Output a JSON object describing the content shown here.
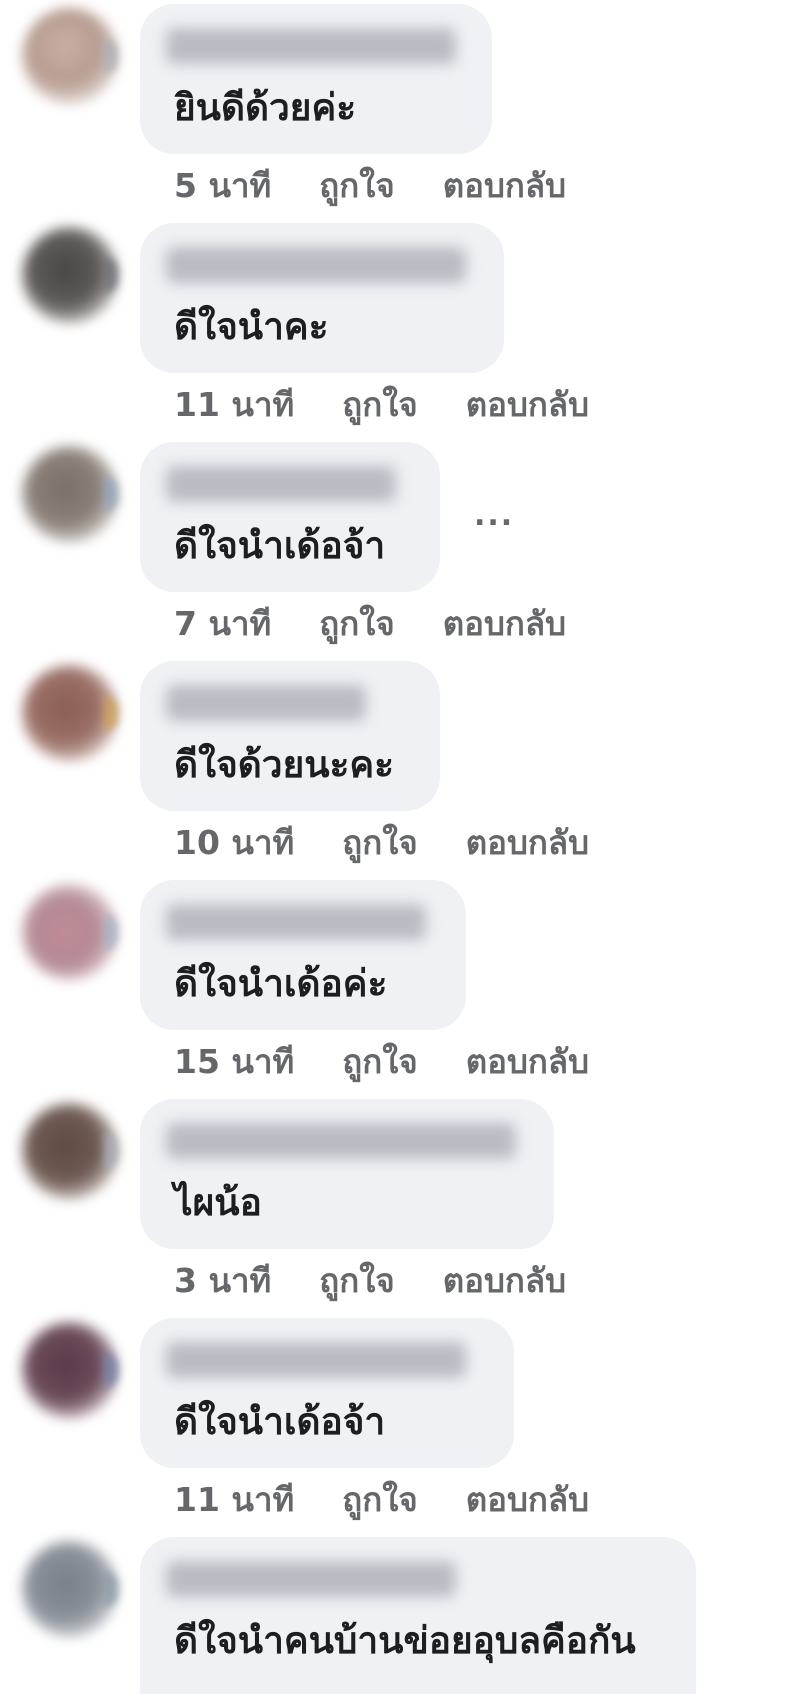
{
  "comments": [
    {
      "text": "ยินดีด้วยค่ะ",
      "time": "5 นาที",
      "like": "ถูกใจ",
      "reply": "ตอบกลับ",
      "avatar_color": "#b79c90"
    },
    {
      "text": "ดีใจนำคะ",
      "time": "11 นาที",
      "like": "ถูกใจ",
      "reply": "ตอบกลับ",
      "avatar_color": "#5e5a58"
    },
    {
      "text": "ดีใจนำเด้อจ้า",
      "time": "7 นาที",
      "like": "ถูกใจ",
      "reply": "ตอบกลับ",
      "avatar_color": "#8a8078"
    },
    {
      "text": "ดีใจด้วยนะคะ",
      "time": "10 นาที",
      "like": "ถูกใจ",
      "reply": "ตอบกลับ",
      "avatar_color": "#9a6f66"
    },
    {
      "text": "ดีใจนำเด้อค่ะ",
      "time": "15 นาที",
      "like": "ถูกใจ",
      "reply": "ตอบกลับ",
      "avatar_color": "#b48a94"
    },
    {
      "text": "ไผน้อ",
      "time": "3 นาที",
      "like": "ถูกใจ",
      "reply": "ตอบกลับ",
      "avatar_color": "#6e5a52"
    },
    {
      "text": "ดีใจนำเด้อจ้า",
      "time": "11 นาที",
      "like": "ถูกใจ",
      "reply": "ตอบกลับ",
      "avatar_color": "#6b4a5a"
    },
    {
      "text": "ดีใจนำคนบ้านข่อยอุบลคือกัน",
      "avatar_color": "#8a9098"
    }
  ],
  "more_menu": {
    "label": "..."
  }
}
